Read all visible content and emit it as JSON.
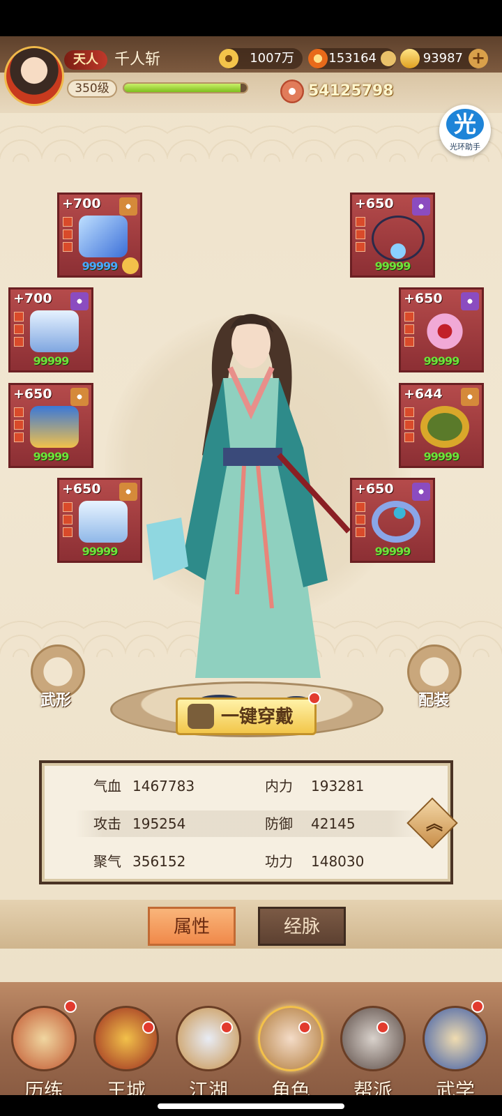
{
  "header": {
    "rank": "天人",
    "player_name": "千人斩",
    "level": "350级",
    "exp_fraction": 0.95,
    "resources": [
      {
        "name": "coin-icon",
        "value": "1007万"
      },
      {
        "name": "flame-icon",
        "value": "153164"
      },
      {
        "name": "ingot-icon",
        "value": "93987"
      }
    ],
    "combat_power": "54125798"
  },
  "helper": {
    "glyph": "光",
    "label": "光环助手"
  },
  "equipment": [
    {
      "slot": "weapon",
      "level": "+700",
      "quality": "gold",
      "stars": "99999",
      "star_color": "blue",
      "linked": true
    },
    {
      "slot": "necklace",
      "level": "+650",
      "quality": "purple",
      "stars": "99999",
      "star_color": "green"
    },
    {
      "slot": "armor",
      "level": "+700",
      "quality": "purple",
      "stars": "99999",
      "star_color": "green"
    },
    {
      "slot": "hairpin",
      "level": "+650",
      "quality": "purple",
      "stars": "99999",
      "star_color": "green"
    },
    {
      "slot": "belt",
      "level": "+650",
      "quality": "gold",
      "stars": "99999",
      "star_color": "green"
    },
    {
      "slot": "bracelet",
      "level": "+644",
      "quality": "gold",
      "stars": "99999",
      "star_color": "green"
    },
    {
      "slot": "boots",
      "level": "+650",
      "quality": "gold",
      "stars": "99999",
      "star_color": "green"
    },
    {
      "slot": "ring",
      "level": "+650",
      "quality": "purple",
      "stars": "99999",
      "star_color": "green"
    }
  ],
  "actions": {
    "left": "武形",
    "right": "配装",
    "equip_all": "一键穿戴"
  },
  "stats": [
    {
      "left_label": "气血",
      "left_value": "1467783",
      "right_label": "内力",
      "right_value": "193281"
    },
    {
      "left_label": "攻击",
      "left_value": "195254",
      "right_label": "防御",
      "right_value": "42145"
    },
    {
      "left_label": "聚气",
      "left_value": "356152",
      "right_label": "功力",
      "right_value": "148030"
    }
  ],
  "tabs": {
    "active": "属性",
    "inactive": "经脉"
  },
  "nav": [
    {
      "label": "历练",
      "badge": true
    },
    {
      "label": "王城",
      "badge": true
    },
    {
      "label": "江湖",
      "badge": true
    },
    {
      "label": "角色",
      "badge": true,
      "active": true
    },
    {
      "label": "帮派",
      "badge": true
    },
    {
      "label": "武学",
      "badge": true
    }
  ]
}
